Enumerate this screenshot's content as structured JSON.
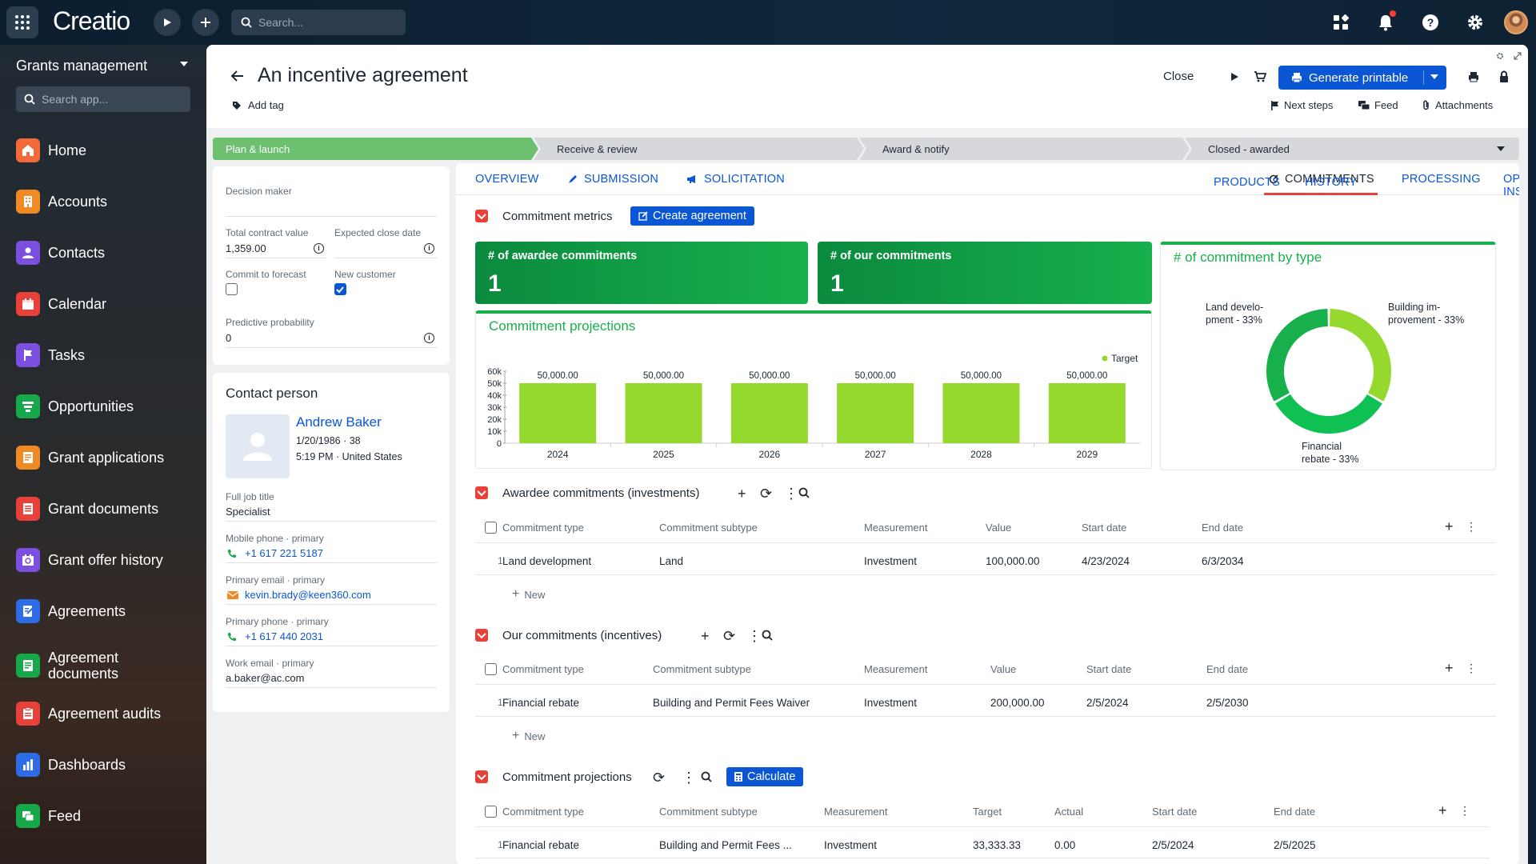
{
  "topbar": {
    "logo": "Creatio",
    "search_placeholder": "Search...",
    "icons": [
      "apps-grid-icon",
      "play-icon",
      "plus-icon",
      "search-icon",
      "widgets-icon",
      "bell-icon",
      "help-icon",
      "gear-icon",
      "avatar"
    ]
  },
  "sidebar": {
    "workspace": "Grants management",
    "search_placeholder": "Search app...",
    "items": [
      {
        "label": "Home",
        "icon": "home-icon",
        "color": "#f2693a"
      },
      {
        "label": "Accounts",
        "icon": "accounts-icon",
        "color": "#f08a24"
      },
      {
        "label": "Contacts",
        "icon": "contacts-icon",
        "color": "#7b4fe0"
      },
      {
        "label": "Calendar",
        "icon": "calendar-icon",
        "color": "#e8413a"
      },
      {
        "label": "Tasks",
        "icon": "flag-icon",
        "color": "#7b4fe0"
      },
      {
        "label": "Opportunities",
        "icon": "funnel-icon",
        "color": "#17a84a"
      },
      {
        "label": "Grant applications",
        "icon": "grant-app-icon",
        "color": "#f08a24"
      },
      {
        "label": "Grant documents",
        "icon": "doc-icon",
        "color": "#e8413a"
      },
      {
        "label": "Grant offer history",
        "icon": "history-icon",
        "color": "#7b4fe0"
      },
      {
        "label": "Agreements",
        "icon": "agreement-icon",
        "color": "#2e6be6"
      },
      {
        "label": "Agreement documents",
        "icon": "agreement-doc-icon",
        "color": "#17a84a"
      },
      {
        "label": "Agreement audits",
        "icon": "audit-icon",
        "color": "#e8413a"
      },
      {
        "label": "Dashboards",
        "icon": "chart-icon",
        "color": "#2e6be6"
      },
      {
        "label": "Feed",
        "icon": "feed-icon",
        "color": "#17a84a"
      }
    ]
  },
  "header": {
    "title": "An incentive agreement",
    "add_tag": "Add tag",
    "close": "Close",
    "generate": "Generate printable",
    "next_steps": "Next steps",
    "feed": "Feed",
    "attachments": "Attachments"
  },
  "stages": [
    "Plan & launch",
    "Receive & review",
    "Award & notify",
    "Closed - awarded"
  ],
  "details": {
    "decision_maker_label": "Decision maker",
    "decision_maker_value": "",
    "total_contract_label": "Total contract value",
    "total_contract_value": "1,359.00",
    "expected_close_label": "Expected close date",
    "commit_forecast_label": "Commit to forecast",
    "commit_forecast_checked": false,
    "new_customer_label": "New customer",
    "new_customer_checked": true,
    "predictive_label": "Predictive probability",
    "predictive_value": "0"
  },
  "contact": {
    "section_title": "Contact person",
    "name": "Andrew Baker",
    "dob": "1/20/1986 · 38",
    "local": "5:19 PM · United States",
    "job_label": "Full job title",
    "job_value": "Specialist",
    "mobile_label": "Mobile phone · primary",
    "mobile_value": "+1 617 221 5187",
    "email_label": "Primary email · primary",
    "email_value": "kevin.brady@keen360.com",
    "phone_label": "Primary phone · primary",
    "phone_value": "+1 617 440 2031",
    "work_email_label": "Work email · primary",
    "work_email_value": "a.baker@ac.com"
  },
  "tabs": [
    {
      "label": "OVERVIEW",
      "icon": ""
    },
    {
      "label": "SUBMISSION",
      "icon": "submission-icon"
    },
    {
      "label": "SOLICITATION",
      "icon": "megaphone-icon"
    },
    {
      "label": "COMMITMENTS",
      "icon": "commitments-icon"
    },
    {
      "label": "PROCESSING",
      "icon": ""
    },
    {
      "label": "OPPORTUNITY INSIGHTS",
      "icon": ""
    },
    {
      "label": "PRODUCTS",
      "icon": ""
    },
    {
      "label": "HISTORY",
      "icon": ""
    }
  ],
  "metrics": {
    "section_title": "Commitment metrics",
    "create_btn": "Create agreement",
    "awardee_title": "# of awardee commitments",
    "awardee_value": "1",
    "ours_title": "# of our commitments",
    "ours_value": "1",
    "donut_title": "# of commitment by type"
  },
  "chart_data": [
    {
      "type": "bar",
      "title": "Commitment projections",
      "categories": [
        "2024",
        "2025",
        "2026",
        "2027",
        "2028",
        "2029"
      ],
      "series": [
        {
          "name": "Target",
          "values": [
            50000,
            50000,
            50000,
            50000,
            50000,
            50000
          ],
          "color": "#96d92e"
        }
      ],
      "data_labels": [
        "50,000.00",
        "50,000.00",
        "50,000.00",
        "50,000.00",
        "50,000.00",
        "50,000.00"
      ],
      "y_ticks": [
        "60k",
        "50k",
        "40k",
        "30k",
        "20k",
        "10k",
        "0"
      ],
      "ylim": [
        0,
        60000
      ],
      "legend": "top-right"
    },
    {
      "type": "pie",
      "title": "# of commitment by type",
      "slices": [
        {
          "label": "Land development - 33%",
          "label_lines": [
            "Land develo-",
            "pment - 33%"
          ],
          "value": 33.33,
          "color": "#17b04c"
        },
        {
          "label": "Building improvement - 33%",
          "label_lines": [
            "Building im-",
            "provement - 33%"
          ],
          "value": 33.33,
          "color": "#96d92e"
        },
        {
          "label": "Financial rebate - 33%",
          "label_lines": [
            "Financial",
            "rebate - 33%"
          ],
          "value": 33.33,
          "color": "#0fc152"
        }
      ]
    }
  ],
  "awardee": {
    "title": "Awardee commitments (investments)",
    "headers": [
      "Commitment type",
      "Commitment subtype",
      "Measurement",
      "Value",
      "Start date",
      "End date"
    ],
    "rows": [
      [
        "1",
        "Land development",
        "Land",
        "Investment",
        "100,000.00",
        "4/23/2024",
        "6/3/2034"
      ]
    ],
    "new": "New"
  },
  "ours": {
    "title": "Our commitments (incentives)",
    "headers": [
      "Commitment type",
      "Commitment subtype",
      "Measurement",
      "Value",
      "Start date",
      "End date"
    ],
    "rows": [
      [
        "1",
        "Financial rebate",
        "Building and Permit Fees Waiver",
        "Investment",
        "200,000.00",
        "2/5/2024",
        "2/5/2030"
      ]
    ],
    "new": "New"
  },
  "projections": {
    "title": "Commitment projections",
    "calc_btn": "Calculate",
    "headers": [
      "Commitment type",
      "Commitment subtype",
      "Measurement",
      "Target",
      "Actual",
      "Start date",
      "End date"
    ],
    "rows": [
      [
        "1",
        "Financial rebate",
        "Building and Permit Fees ...",
        "Investment",
        "33,333.33",
        "0.00",
        "2/5/2024",
        "2/5/2025"
      ]
    ]
  }
}
